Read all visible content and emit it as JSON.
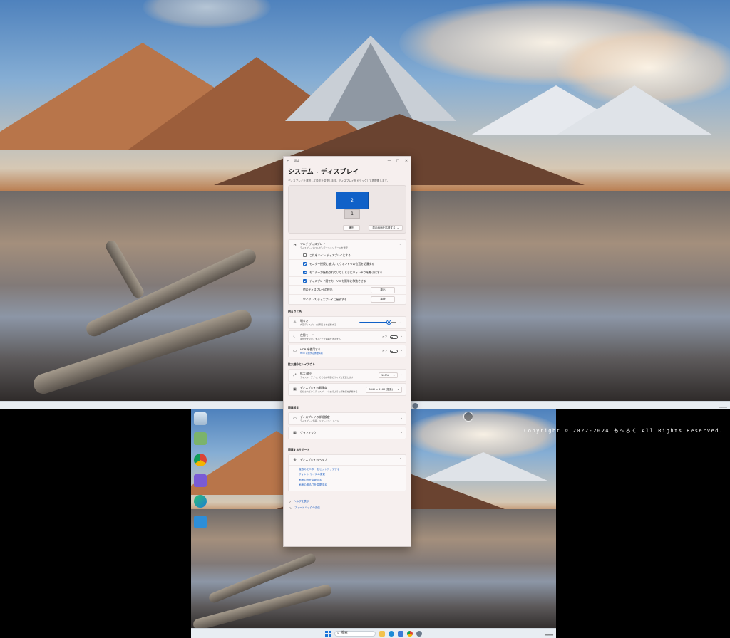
{
  "window": {
    "app_title": "設定",
    "controls": [
      "—",
      "□",
      "✕"
    ]
  },
  "breadcrumb": {
    "parent": "システム",
    "separator": "›",
    "current": "ディスプレイ"
  },
  "arrangement": {
    "hint": "ディスプレイを選択して設定を変更します。ディスプレイをドラッグして再配置します。",
    "monitor_primary": "2",
    "monitor_secondary": "1",
    "identify_button": "識別",
    "extend_dropdown": "表示画面を拡張する"
  },
  "multi_display": {
    "title": "マルチ ディスプレイ",
    "subtitle": "ディスプレイのプレゼンテーション モードを選択",
    "options": [
      {
        "label": "これをメイン ディスプレイにする",
        "checked": false
      },
      {
        "label": "モニター接続に基づいてウィンドウの位置を記憶する",
        "checked": true
      },
      {
        "label": "モニターが接続されていないときにウィンドウを最小化する",
        "checked": true
      },
      {
        "label": "ディスプレイ間でカーソルを簡単に移動させる",
        "checked": true
      }
    ],
    "detect_label": "他のディスプレイの検出",
    "detect_button": "検出",
    "wireless_label": "ワイヤレス ディスプレイに接続する",
    "wireless_button": "接続"
  },
  "brightness_color": {
    "section": "明るさと色",
    "brightness_title": "明るさ",
    "brightness_sub": "内蔵ディスプレイの明るさを調整する",
    "brightness_value": 0.82,
    "night_title": "夜間モード",
    "night_sub": "青色光を少なくすることで睡眠を改善する",
    "night_state": "オフ",
    "hdr_title": "HDR を使用する",
    "hdr_sub": "HDR に関する詳細情報",
    "hdr_state": "オフ"
  },
  "scale_layout": {
    "section": "拡大縮小とレイアウト",
    "scale_title": "拡大/縮小",
    "scale_sub": "テキスト、アプリ、その他の項目のサイズを変更します",
    "scale_value": "100%",
    "res_title": "ディスプレイの解像度",
    "res_sub": "接続されているディスプレイに合うように解像度を調整する",
    "res_value": "3840 × 2160 (推奨)"
  },
  "related": {
    "section": "関連設定",
    "advanced_title": "ディスプレイの詳細設定",
    "advanced_sub": "ディスプレイ情報、リフレッシュ レート",
    "graphics_title": "グラフィック"
  },
  "support": {
    "section": "関連するサポート",
    "help_title": "ディスプレイのヘルプ",
    "links": [
      "複数のモニターをセットアップする",
      "フォント サイズの変更",
      "画面の色を変更する",
      "画面の明るさを変更する"
    ]
  },
  "footer": {
    "help": "ヘルプを表示",
    "feedback": "フィードバックの送信"
  },
  "taskbar": {
    "search_placeholder": "検索"
  },
  "desktop": {
    "copyright": "Copyright © 2022-2024 も～ろく All Rights Reserved."
  },
  "colors": {
    "accent": "#1061c8",
    "window_bg": "#f6efee",
    "link": "#1a5cc0"
  },
  "icons": [
    "search-icon",
    "windows-logo-icon",
    "chevron-down-icon",
    "chevron-right-icon",
    "monitor-icon",
    "sun-icon",
    "moon-icon",
    "hdr-icon",
    "scale-icon",
    "resolution-icon",
    "graphics-icon",
    "help-icon",
    "feedback-icon",
    "recycle-bin-icon"
  ]
}
